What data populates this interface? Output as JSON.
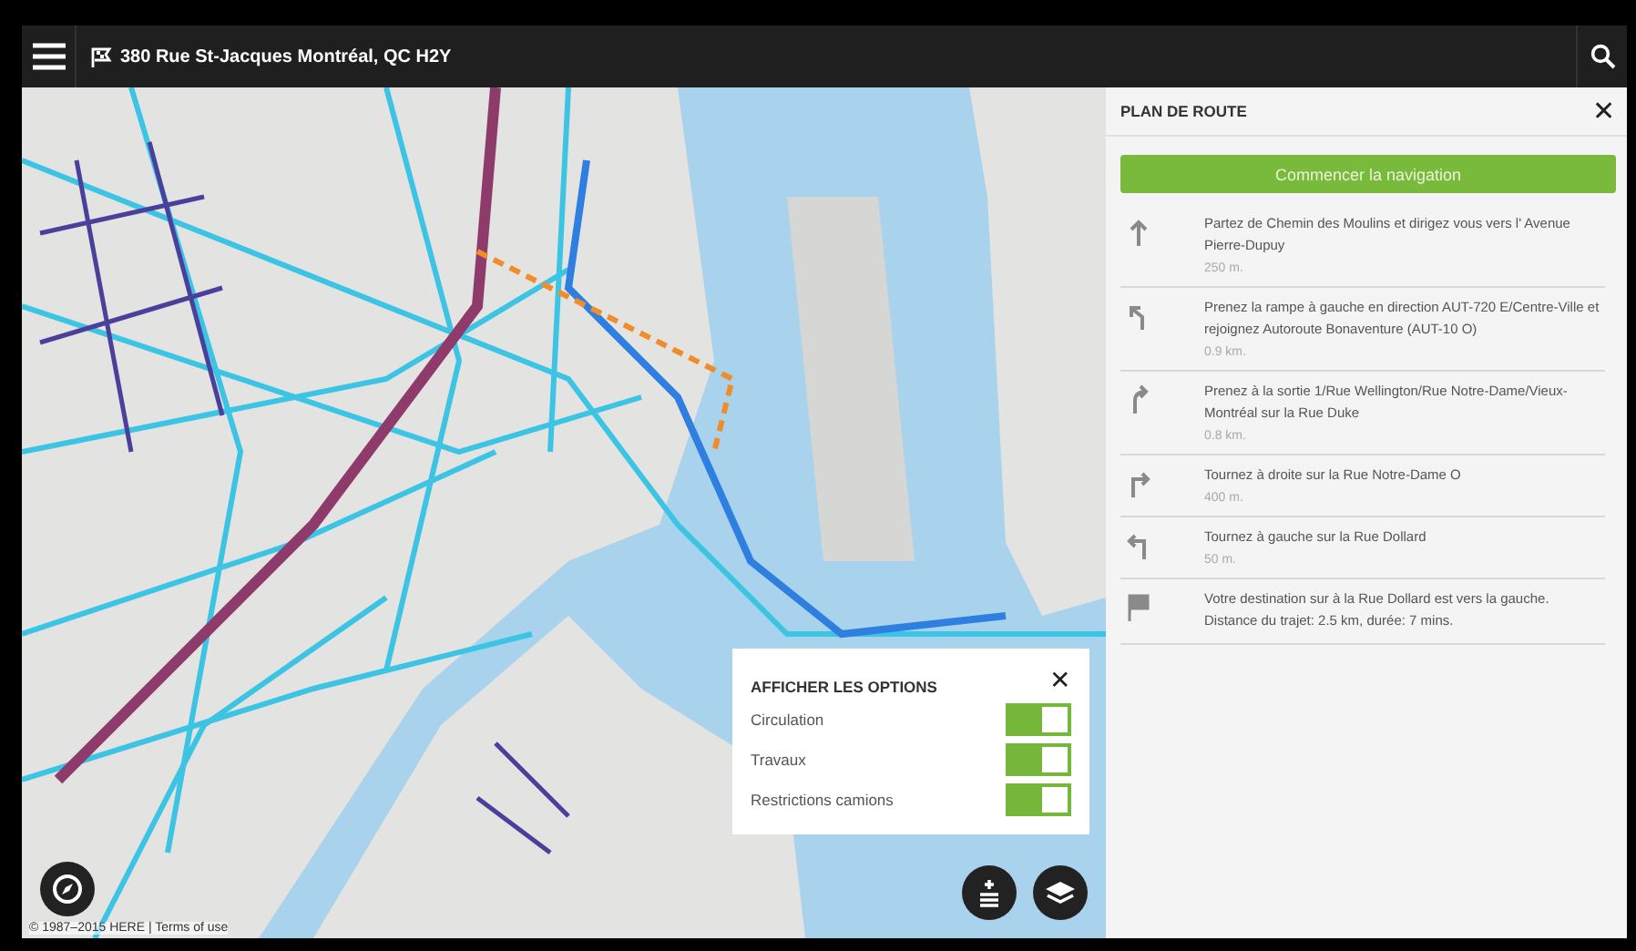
{
  "top_bar": {
    "destination": "380 Rue St-Jacques Montréal, QC H2Y"
  },
  "map": {
    "copyright": "© 1987–2015 HERE | Terms of use"
  },
  "options_popup": {
    "title": "AFFICHER LES OPTIONS",
    "close": "✕",
    "toggles": [
      {
        "label": "Circulation",
        "on": true
      },
      {
        "label": "Travaux",
        "on": true
      },
      {
        "label": "Restrictions camions",
        "on": true
      }
    ]
  },
  "route_panel": {
    "title": "PLAN DE ROUTE",
    "close": "✕",
    "start_button": "Commencer la navigation",
    "steps": [
      {
        "kind": "straight",
        "text": "Partez de Chemin des Moulins et dirigez vous vers l' Avenue Pierre-Dupuy",
        "distance": "250 m."
      },
      {
        "kind": "ramp-left",
        "text": "Prenez la rampe à gauche en direction AUT-720 E/Centre-Ville et rejoignez Autoroute Bonaventure (AUT-10 O)",
        "distance": "0.9 km."
      },
      {
        "kind": "exit-right",
        "text": "Prenez à la sortie 1/Rue Wellington/Rue Notre-Dame/Vieux-Montréal sur la Rue Duke",
        "distance": "0.8 km."
      },
      {
        "kind": "turn-right",
        "text": "Tournez à droite sur la Rue Notre-Dame O",
        "distance": "400 m."
      },
      {
        "kind": "turn-left",
        "text": "Tournez à gauche sur la Rue Dollard",
        "distance": "50 m."
      },
      {
        "kind": "destination",
        "text": "Votre destination sur à la Rue Dollard est vers la gauche. Distance du trajet: 2.5 km, durée: 7 mins."
      }
    ]
  }
}
